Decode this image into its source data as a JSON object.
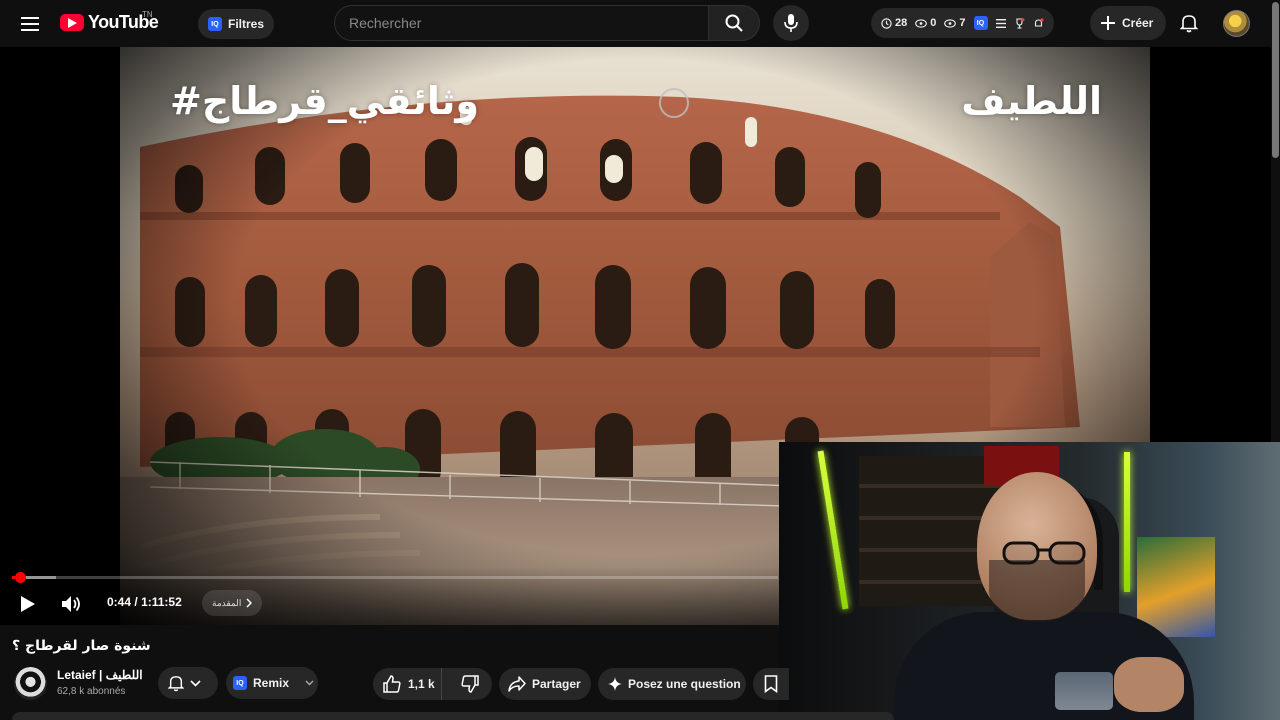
{
  "header": {
    "logo_text": "YouTube",
    "logo_superscript": "TN",
    "filters_label": "Filtres",
    "filters_badge": "IQ",
    "search_placeholder": "Rechercher",
    "stats": {
      "watch_time": "28",
      "views_a": "0",
      "views_b": "7",
      "badge": "IQ"
    },
    "create_label": "Créer",
    "accent_color": "#ff0033"
  },
  "player": {
    "overlay_left": "#وثائقي_قرطاج",
    "overlay_right": "اللطيف",
    "time_current": "0:44",
    "time_separator": "/",
    "time_total": "1:11:52",
    "chapter_label": "المقدمة",
    "progress_fraction": 0.0102,
    "buffered_fraction": 0.057,
    "progress_color": "#ff0000"
  },
  "video": {
    "title": "شنوة صار لقرطاج ؟",
    "channel_name": "Letaief | اللطيف",
    "subscribers": "62,8 k abonnés",
    "remix_label": "Remix",
    "remix_badge": "IQ",
    "like_count": "1,1 k",
    "share_label": "Partager",
    "ask_label": "Posez une question"
  }
}
